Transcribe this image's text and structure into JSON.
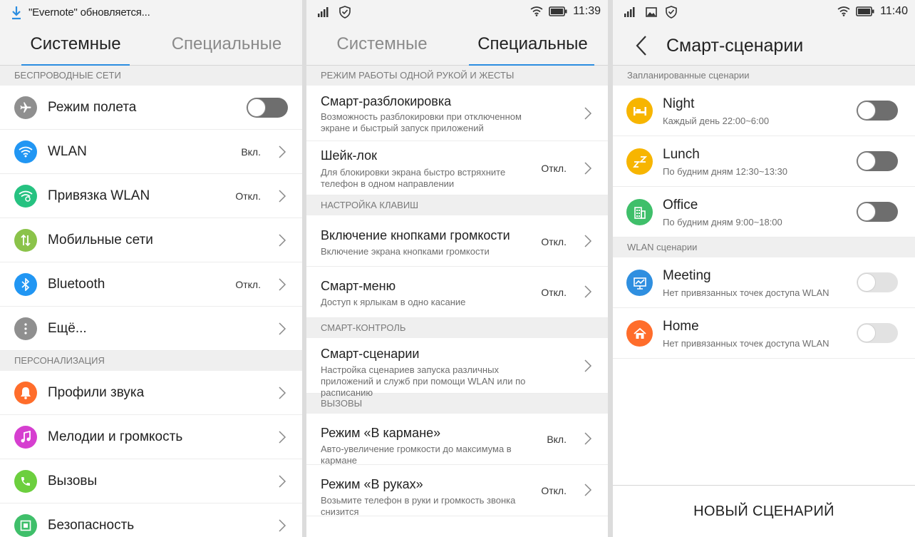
{
  "panel1": {
    "status": {
      "notification": "\"Evernote\" обновляется..."
    },
    "tabs": [
      {
        "label": "Системные",
        "active": true
      },
      {
        "label": "Специальные",
        "active": false
      }
    ],
    "sections": [
      {
        "title": "БЕСПРОВОДНЫЕ СЕТИ",
        "items": [
          {
            "label": "Режим полета",
            "value": "",
            "icon": "airplane-icon",
            "color": "#8f8f8f",
            "control": "toggle"
          },
          {
            "label": "WLAN",
            "value": "Вкл.",
            "icon": "wifi-icon",
            "color": "#2196f3",
            "control": "chevron"
          },
          {
            "label": "Привязка WLAN",
            "value": "Откл.",
            "icon": "wifi-hotspot-icon",
            "color": "#26c281",
            "control": "chevron"
          },
          {
            "label": "Мобильные сети",
            "value": "",
            "icon": "mobile-data-icon",
            "color": "#8bc34a",
            "control": "chevron"
          },
          {
            "label": "Bluetooth",
            "value": "Откл.",
            "icon": "bluetooth-icon",
            "color": "#2196f3",
            "control": "chevron"
          },
          {
            "label": "Ещё...",
            "value": "",
            "icon": "more-icon",
            "color": "#8f8f8f",
            "control": "chevron"
          }
        ]
      },
      {
        "title": "ПЕРСОНАЛИЗАЦИЯ",
        "items": [
          {
            "label": "Профили звука",
            "value": "",
            "icon": "bell-icon",
            "color": "#ff6d2b",
            "control": "chevron"
          },
          {
            "label": "Мелодии и громкость",
            "value": "",
            "icon": "music-note-icon",
            "color": "#d63fd0",
            "control": "chevron"
          },
          {
            "label": "Вызовы",
            "value": "",
            "icon": "phone-icon",
            "color": "#6ccf3e",
            "control": "chevron"
          },
          {
            "label": "Безопасность",
            "value": "",
            "icon": "security-icon",
            "color": "#3fbf6a",
            "control": "chevron"
          }
        ]
      }
    ]
  },
  "panel2": {
    "status": {
      "time": "11:39"
    },
    "tabs": [
      {
        "label": "Системные",
        "active": false
      },
      {
        "label": "Специальные",
        "active": true
      }
    ],
    "sections": [
      {
        "title": "РЕЖИМ РАБОТЫ ОДНОЙ РУКОЙ И ЖЕСТЫ",
        "items": [
          {
            "title": "Смарт-разблокировка",
            "subtitle": "Возможность разблокировки при отключенном экране и быстрый запуск приложений",
            "value": ""
          },
          {
            "title": "Шейк-лок",
            "subtitle": "Для блокировки экрана быстро встряхните телефон в одном направлении",
            "value": "Откл."
          }
        ]
      },
      {
        "title": "НАСТРОЙКА КЛАВИШ",
        "items": [
          {
            "title": "Включение кнопками громкости",
            "subtitle": "Включение экрана кнопками громкости",
            "value": "Откл."
          },
          {
            "title": "Смарт-меню",
            "subtitle": "Доступ к ярлыкам в одно касание",
            "value": "Откл."
          }
        ]
      },
      {
        "title": "СМАРТ-КОНТРОЛЬ",
        "items": [
          {
            "title": "Смарт-сценарии",
            "subtitle": "Настройка сценариев запуска различных приложений и служб при помощи WLAN или по расписанию",
            "value": ""
          }
        ]
      },
      {
        "title": "ВЫЗОВЫ",
        "items": [
          {
            "title": "Режим «В кармане»",
            "subtitle": "Авто-увеличение громкости до максимума в кармане",
            "value": "Вкл."
          },
          {
            "title": "Режим «В руках»",
            "subtitle": "Возьмите телефон в руки и громкость звонка снизится",
            "value": "Откл."
          }
        ]
      }
    ]
  },
  "panel3": {
    "status": {
      "time": "11:40"
    },
    "title": "Смарт-сценарии",
    "sections": [
      {
        "title": "Запланированные сценарии",
        "items": [
          {
            "title": "Night",
            "subtitle": "Каждый день 22:00~6:00",
            "icon": "bed-icon",
            "color": "#f7b500",
            "enabled": true
          },
          {
            "title": "Lunch",
            "subtitle": "По будним дням 12:30~13:30",
            "icon": "sleep-zz-icon",
            "color": "#f7b500",
            "enabled": true
          },
          {
            "title": "Office",
            "subtitle": "По будним дням 9:00~18:00",
            "icon": "office-building-icon",
            "color": "#3fbf6a",
            "enabled": true
          }
        ]
      },
      {
        "title": "WLAN сценарии",
        "items": [
          {
            "title": "Meeting",
            "subtitle": "Нет привязанных точек доступа WLAN",
            "icon": "presentation-icon",
            "color": "#2f8fe0",
            "enabled": false
          },
          {
            "title": "Home",
            "subtitle": "Нет привязанных точек доступа WLAN",
            "icon": "home-icon",
            "color": "#ff6d2b",
            "enabled": false
          }
        ]
      }
    ],
    "new_button": "НОВЫЙ СЦЕНАРИЙ"
  }
}
